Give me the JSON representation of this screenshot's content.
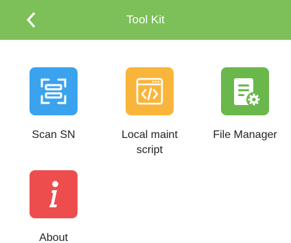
{
  "header": {
    "title": "Tool Kit",
    "back_icon": "chevron-left-icon",
    "color": "#7dbf59"
  },
  "tiles": [
    {
      "label": "Scan SN",
      "icon": "scan-icon",
      "color": "#3ba2ee"
    },
    {
      "label": "Local maint script",
      "icon": "code-file-icon",
      "color": "#f9b53b"
    },
    {
      "label": "File Manager",
      "icon": "file-settings-icon",
      "color": "#6ab84c"
    },
    {
      "label": "About",
      "icon": "info-icon",
      "color": "#ee4d4d"
    }
  ]
}
